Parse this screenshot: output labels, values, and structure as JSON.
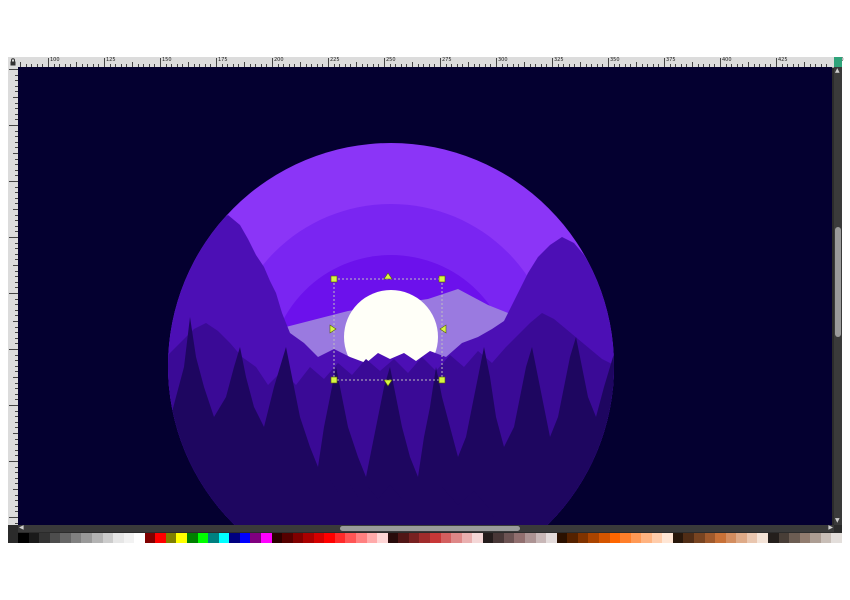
{
  "ruler": {
    "labels": [
      "100",
      "125",
      "150",
      "175",
      "200",
      "225",
      "250",
      "275",
      "300",
      "325",
      "350",
      "375",
      "400",
      "425",
      "450"
    ]
  },
  "icons": {
    "lock": "lock-icon",
    "zoom_correction": "zoom-correction-icon",
    "scroll_left": "scroll-left-arrow-icon",
    "scroll_right": "scroll-right-arrow-icon",
    "scroll_up": "scroll-up-arrow-icon",
    "scroll_down": "scroll-down-arrow-icon"
  },
  "colors": {
    "canvas_background": "#040030",
    "sky_outer": "#8b35f7",
    "sky_mid": "#7a25f2",
    "sky_inner": "#6c11ec",
    "sky_core": "#5a09d8",
    "mountain": "#9a7ae0",
    "sun": "#fffff8",
    "trees_back": "#4c0fb5",
    "trees_mid": "#3a0a96",
    "trees_front": "#1e0660",
    "selection_handle": "#d6f542"
  },
  "palette": [
    "#000000",
    "#1a1a1a",
    "#333333",
    "#4d4d4d",
    "#666666",
    "#808080",
    "#999999",
    "#b3b3b3",
    "#cccccc",
    "#e6e6e6",
    "#f2f2f2",
    "#ffffff",
    "#800000",
    "#ff0000",
    "#808000",
    "#ffff00",
    "#008000",
    "#00ff00",
    "#008080",
    "#00ffff",
    "#000080",
    "#0000ff",
    "#800080",
    "#ff00ff",
    "#2b0000",
    "#550000",
    "#800000",
    "#aa0000",
    "#d40000",
    "#ff0000",
    "#ff2a2a",
    "#ff5555",
    "#ff8080",
    "#ffaaaa",
    "#ffd5d5",
    "#280b0b",
    "#501616",
    "#782121",
    "#a02c2c",
    "#c83737",
    "#d35f5f",
    "#de8787",
    "#e9afaf",
    "#f4d7d7",
    "#241c1c",
    "#483737",
    "#6c5353",
    "#916f6f",
    "#ac9393",
    "#c8b7b7",
    "#e3dbdb",
    "#2b1100",
    "#552200",
    "#803300",
    "#aa4400",
    "#d45500",
    "#ff6600",
    "#ff7f2a",
    "#ff9955",
    "#ffb380",
    "#ffccaa",
    "#ffe6d5",
    "#28170b",
    "#502d16",
    "#784421",
    "#a05a2c",
    "#c87137",
    "#d38d5f",
    "#deaa87",
    "#e9c6af",
    "#f4e3d7",
    "#241f1c",
    "#483e37",
    "#6c5d53",
    "#917c6f",
    "#ac9d93",
    "#c8beb7",
    "#e3dedb"
  ]
}
